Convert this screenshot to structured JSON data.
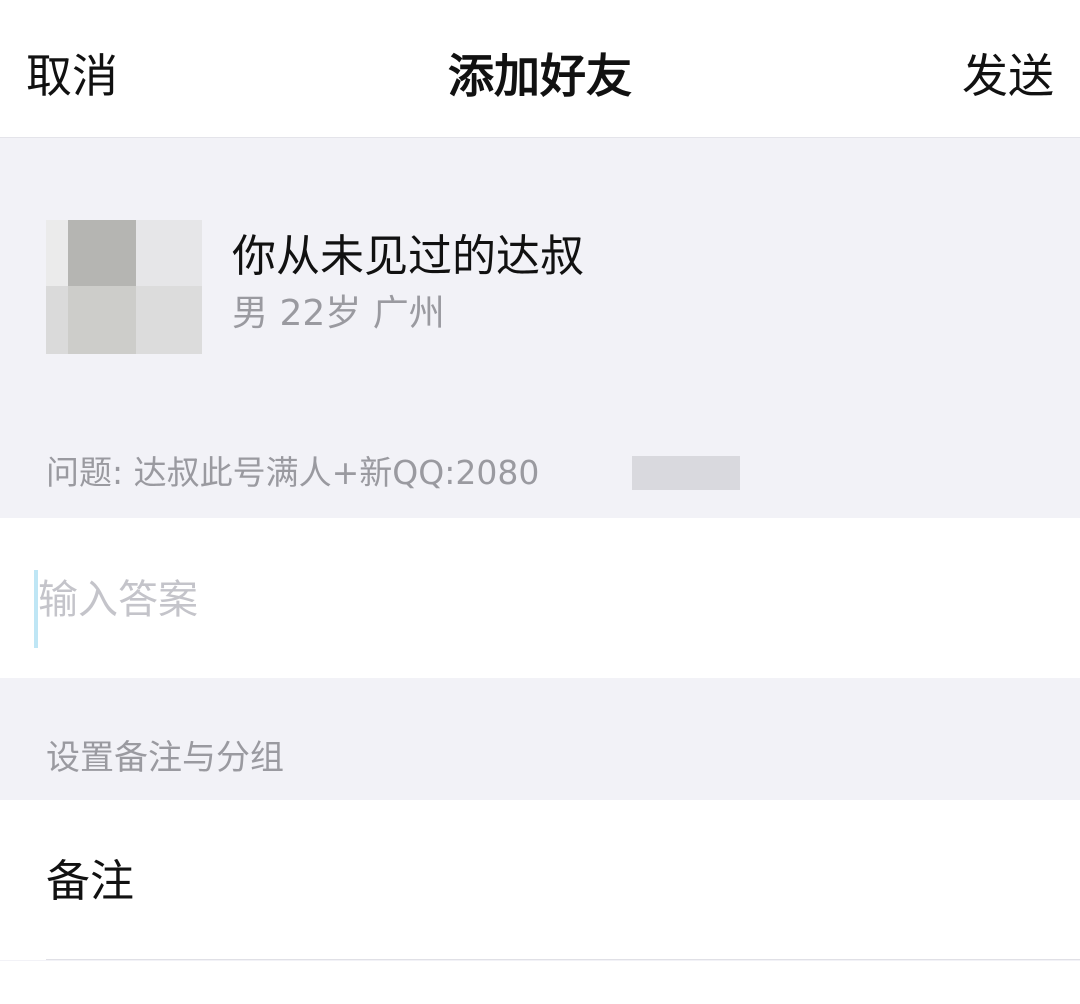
{
  "navbar": {
    "cancel_label": "取消",
    "title": "添加好友",
    "send_label": "发送"
  },
  "profile": {
    "name": "你从未见过的达叔",
    "meta": "男 22岁 广州"
  },
  "question": {
    "text": "问题: 达叔此号满人+新QQ:2080"
  },
  "answer": {
    "placeholder": "输入答案",
    "value": ""
  },
  "section": {
    "label": "设置备注与分组"
  },
  "remark": {
    "label": "备注"
  }
}
